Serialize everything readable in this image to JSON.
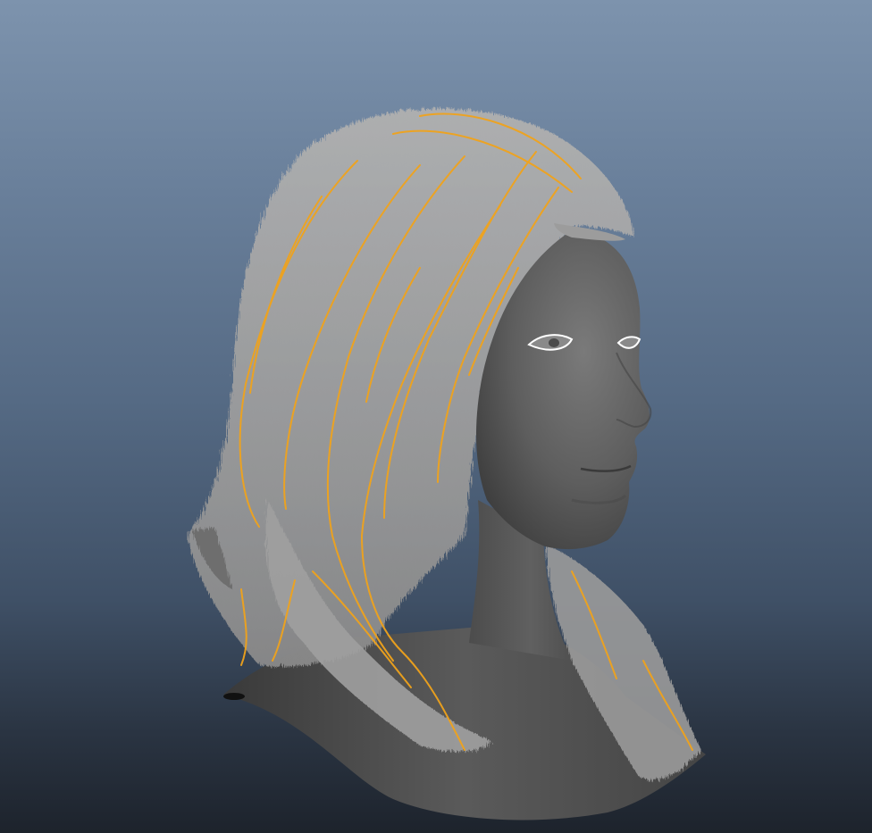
{
  "viewport": {
    "view": "perspective",
    "background_gradient": [
      "#7d93ad",
      "#1d232c"
    ]
  },
  "scene": {
    "objects": [
      {
        "name": "head-mesh",
        "shading": "smooth-shaded",
        "color": "#5c5c5c"
      },
      {
        "name": "hair-system",
        "color": "#a6a6a6"
      },
      {
        "name": "guide-curves",
        "selected": true,
        "highlight_color": "#f0a31c"
      },
      {
        "name": "eye-wireframe",
        "highlight_color": "#ffffff"
      }
    ]
  }
}
